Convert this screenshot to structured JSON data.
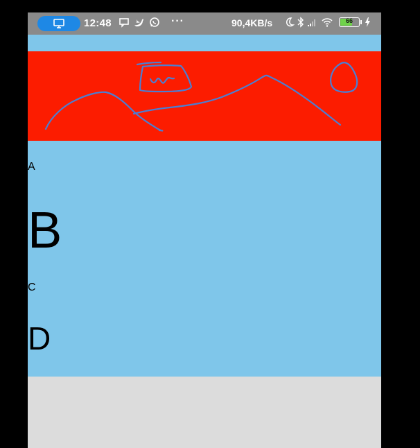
{
  "status_bar": {
    "time": "12:48",
    "notification_icons": [
      "screen-icon",
      "message-icon",
      "twitter-icon",
      "whatsapp-icon"
    ],
    "more": "···",
    "network_speed": "90,4KB/s",
    "battery_level": "66",
    "battery_fraction": 0.66,
    "system_icons": [
      "moon-icon",
      "bluetooth-icon",
      "signal-icon",
      "wifi-icon",
      "charging-icon"
    ]
  },
  "canvas": {
    "background_color": "#fc1c00",
    "stroke_color": "#4a7fd4"
  },
  "letters": {
    "a": "A",
    "b": "B",
    "c": "C",
    "d": "D"
  },
  "colors": {
    "app_background": "#7fc6ea",
    "bottom_background": "#dcdcdc",
    "status_bar": "#8a8a8a",
    "status_pill": "#1e88e5"
  }
}
